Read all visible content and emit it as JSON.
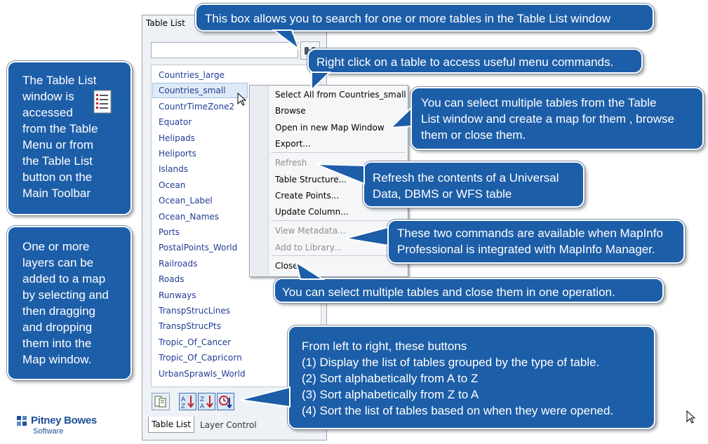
{
  "window": {
    "title": "Table List",
    "tables": [
      "Countries_large",
      "Countries_small",
      "CountrTimeZone2",
      "Equator",
      "Helipads",
      "Heliports",
      "Islands",
      "Ocean",
      "Ocean_Label",
      "Ocean_Names",
      "Ports",
      "PostalPoints_World",
      "Railroads",
      "Roads",
      "Runways",
      "TranspStrucLines",
      "TranspStrucPts",
      "Tropic_Of_Cancer",
      "Tropic_Of_Capricorn",
      "UrbanSprawls_World"
    ],
    "selected_table": "Countries_small",
    "tabs": [
      "Table List",
      "Layer Control"
    ],
    "toolbar_icons": [
      "group-by-type-icon",
      "sort-a-to-z-icon",
      "sort-z-to-a-icon",
      "sort-by-open-time-icon"
    ]
  },
  "context_menu": {
    "items": [
      {
        "label": "Select All from Countries_small",
        "enabled": true
      },
      {
        "label": "Browse",
        "enabled": true
      },
      {
        "label": "Open in new Map Window",
        "enabled": true
      },
      {
        "label": "Export...",
        "enabled": true
      },
      {
        "label": "Refresh",
        "enabled": false
      },
      {
        "label": "Table Structure...",
        "enabled": true
      },
      {
        "label": "Create Points...",
        "enabled": true
      },
      {
        "label": "Update Column...",
        "enabled": true
      },
      {
        "label": "View Metadata...",
        "enabled": false
      },
      {
        "label": "Add to Library...",
        "enabled": false
      },
      {
        "label": "Close",
        "enabled": true
      }
    ]
  },
  "callouts": {
    "table_list_access": "The Table List\nwindow is\naccessed\nfrom the Table\nMenu or from\nthe Table List\nbutton on the\nMain Toolbar",
    "layers": "One or more\nlayers can be\nadded to a map\nby selecting  and\nthen dragging\nand dropping\nthem into the\nMap window.",
    "search": "This box allows you to search for one or more tables in the Table List window",
    "right_click": "Right click on a table to access useful menu commands.",
    "multi_select": "You can select multiple tables from the Table\nList window and create a map for them , browse\nthem or close them.",
    "refresh": "Refresh the contents of a Universal\nData, DBMS or WFS table",
    "metadata": "These two commands are available when MapInfo\nProfessional is integrated with MapInfo Manager.",
    "close": "You can select multiple tables and close them in one operation.",
    "buttons": "From left to right, these buttons\n(1) Display the list of tables grouped by the type of table.\n(2) Sort alphabetically from A to Z\n(3) Sort alphabetically from Z to A\n(4) Sort the list of tables based on when they were opened."
  },
  "brand": {
    "name": "Pitney Bowes",
    "sub": "Software"
  },
  "colors": {
    "callout_fill": "#1d5ea8",
    "link_text": "#1f3d96",
    "brand": "#1c4f94"
  }
}
